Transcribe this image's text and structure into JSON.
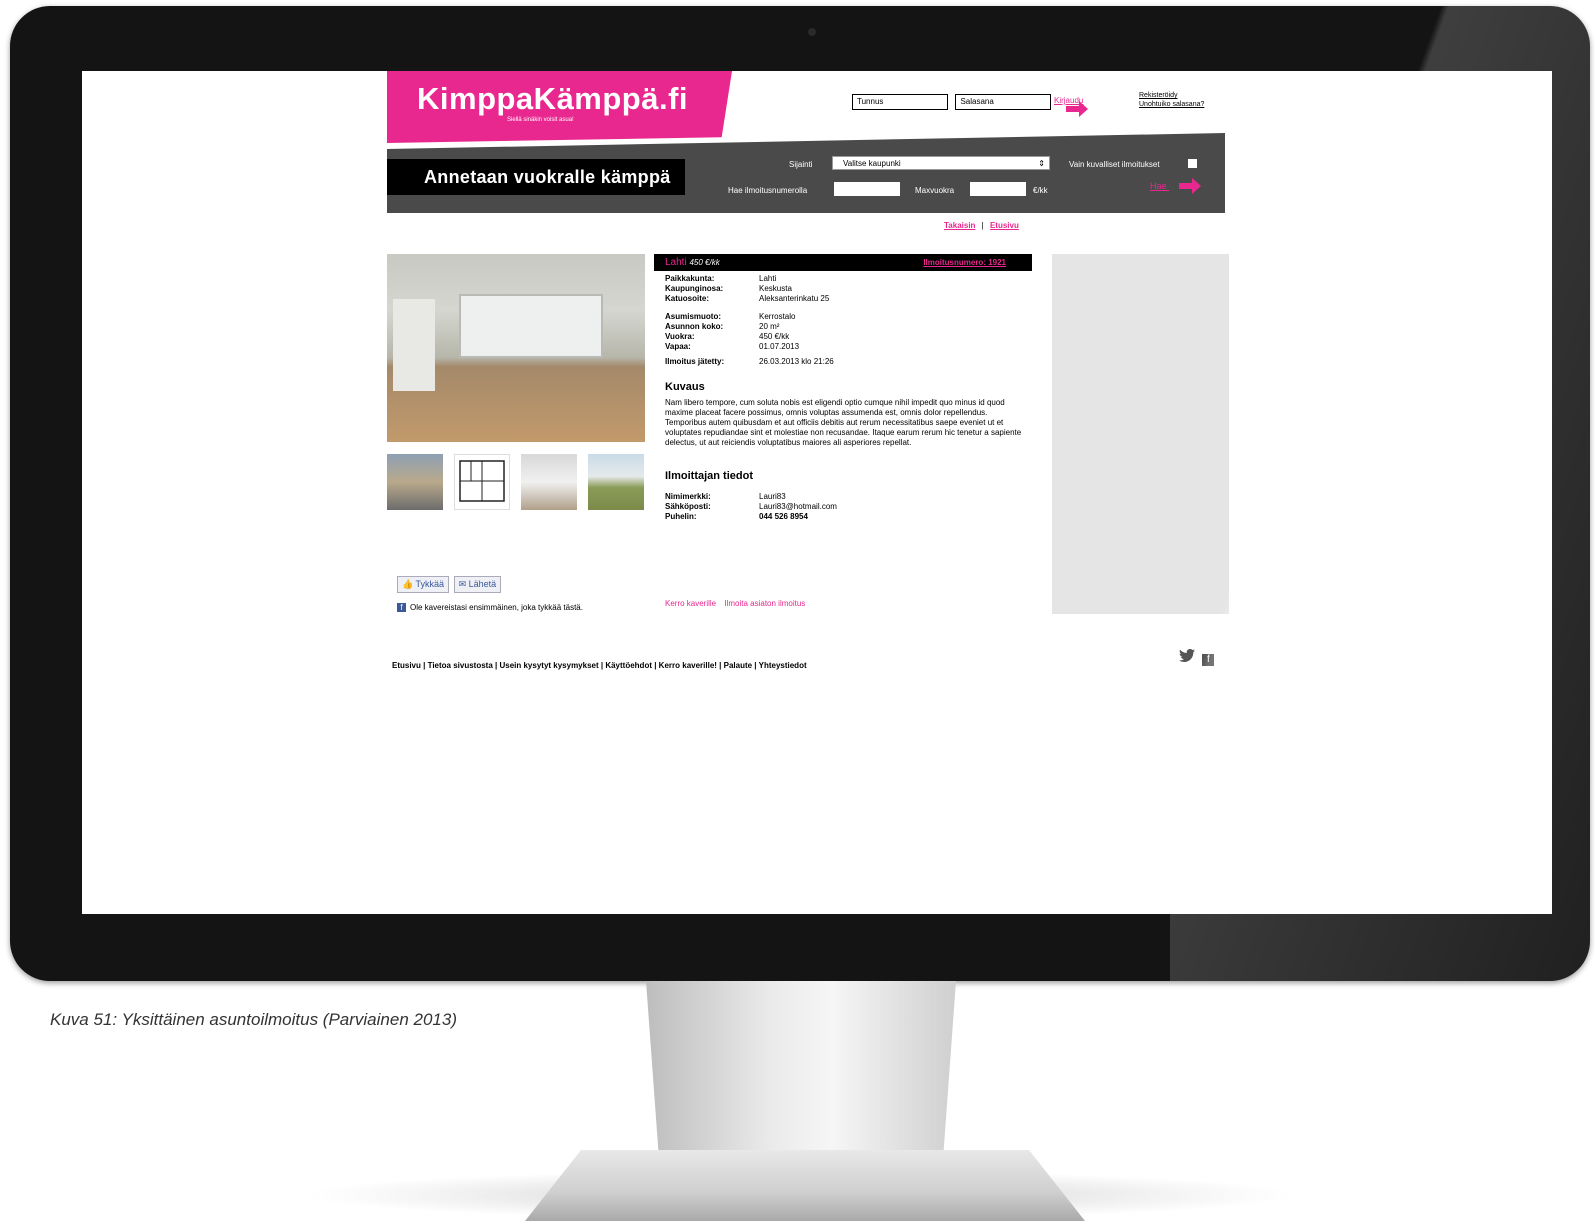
{
  "site": {
    "logo": "KimppaKämppä.fi",
    "tagline": "Siellä sinäkin voisit asua!",
    "login": {
      "username_placeholder": "Tunnus",
      "password_placeholder": "Salasana",
      "login_link": "Kirjaudu",
      "register": "Rekisteröidy",
      "forgot": "Unohtuiko salasana?"
    },
    "search": {
      "page_title": "Annetaan vuokralle kämppä",
      "location_label": "Sijainti",
      "location_value": "Valitse kaupunki",
      "photo_only_label": "Vain kuvalliset ilmoitukset",
      "ad_number_label": "Hae ilmoitusnumerolla",
      "max_rent_label": "Maxvuokra",
      "rent_unit": "€/kk",
      "search_button": "Hae"
    },
    "breadcrumb": {
      "back": "Takaisin",
      "separator": "|",
      "home": "Etusivu"
    },
    "listing": {
      "city": "Lahti",
      "price": "450 €/kk",
      "ad_number": "Ilmoitusnumero: 1921",
      "fields": [
        {
          "label": "Paikkakunta:",
          "value": "Lahti"
        },
        {
          "label": "Kaupunginosa:",
          "value": "Keskusta"
        },
        {
          "label": "Katuosoite:",
          "value": "Aleksanterinkatu 25"
        }
      ],
      "fields2": [
        {
          "label": "Asumismuoto:",
          "value": "Kerrostalo"
        },
        {
          "label": "Asunnon koko:",
          "value": "20 m²"
        },
        {
          "label": "Vuokra:",
          "value": "450 €/kk"
        },
        {
          "label": "Vapaa:",
          "value": "01.07.2013"
        }
      ],
      "posted_label": "Ilmoitus jätetty:",
      "posted_value": "26.03.2013 klo 21:26",
      "description_title": "Kuvaus",
      "description": "Nam libero tempore, cum soluta nobis est eligendi optio cumque nihil impedit quo minus id quod maxime placeat facere possimus, omnis voluptas assumenda est, omnis dolor repellendus. Temporibus autem quibusdam et aut officiis debitis aut rerum necessitatibus saepe eveniet ut et voluptates repudiandae sint et molestiae non recusandae. Itaque earum rerum hic tenetur a sapiente delectus, ut aut reiciendis voluptatibus maiores ali asperiores repellat.",
      "seller_title": "Ilmoittajan tiedot",
      "seller": [
        {
          "label": "Nimimerkki:",
          "value": "Lauri83"
        },
        {
          "label": "Sähköposti:",
          "value": "Lauri83@hotmail.com"
        },
        {
          "label": "Puhelin:",
          "value": "044 526 8954"
        }
      ],
      "tell_friend": "Kerro kaverille",
      "report": "Ilmoita asiaton ilmoitus"
    },
    "social": {
      "like": "Tykkää",
      "send": "Lähetä",
      "fb_text": "Ole kavereistasi ensimmäinen, joka tykkää tästä."
    },
    "footer": "Etusivu  |  Tietoa sivustosta  |  Usein kysytyt kysymykset  |  Käyttöehdot  |  Kerro kaverille!  |  Palaute  |  Yhteystiedot"
  },
  "caption": "Kuva 51: Yksittäinen asuntoilmoitus (Parviainen 2013)",
  "colors": {
    "brand": "#e8288e",
    "bar": "#4a4a4a"
  }
}
